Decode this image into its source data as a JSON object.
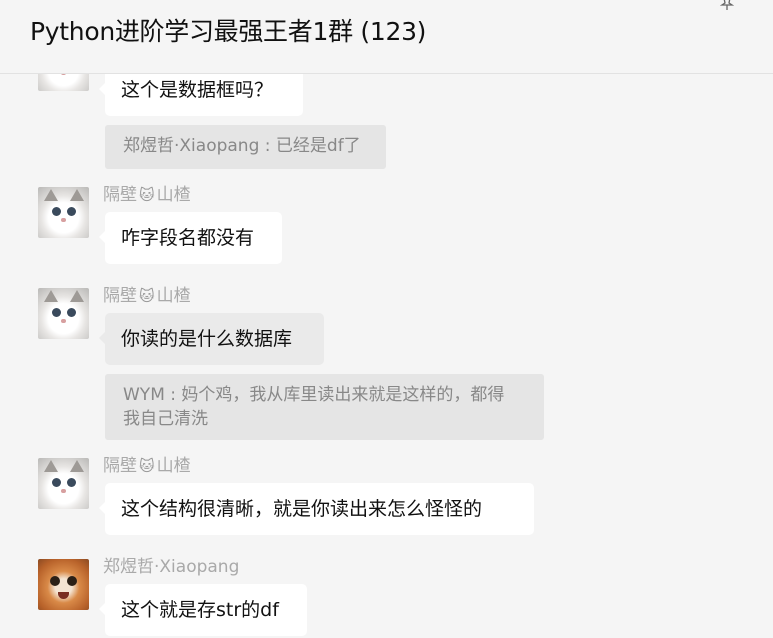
{
  "header": {
    "title": "Python进阶学习最强王者1群 (123)"
  },
  "messages": [
    {
      "sender": "",
      "text": "这个是数据框吗？",
      "quote": "郑煜哲·Xiaopang : 已经是df了"
    },
    {
      "sender_prefix": "隔壁",
      "sender_emoji": "🐱",
      "sender_suffix": "山楂",
      "text": "咋字段名都没有"
    },
    {
      "sender_prefix": "隔壁",
      "sender_emoji": "🐱",
      "sender_suffix": "山楂",
      "text": "你读的是什么数据库",
      "quote_line1": "WYM : 妈个鸡，我从库里读出来就是这样的，都得",
      "quote_line2": "我自己清洗"
    },
    {
      "sender_prefix": "隔壁",
      "sender_emoji": "🐱",
      "sender_suffix": "山楂",
      "text": "这个结构很清晰，就是你读出来怎么怪怪的"
    },
    {
      "sender": "郑煜哲·Xiaopang",
      "text": "这个就是存str的df"
    }
  ]
}
